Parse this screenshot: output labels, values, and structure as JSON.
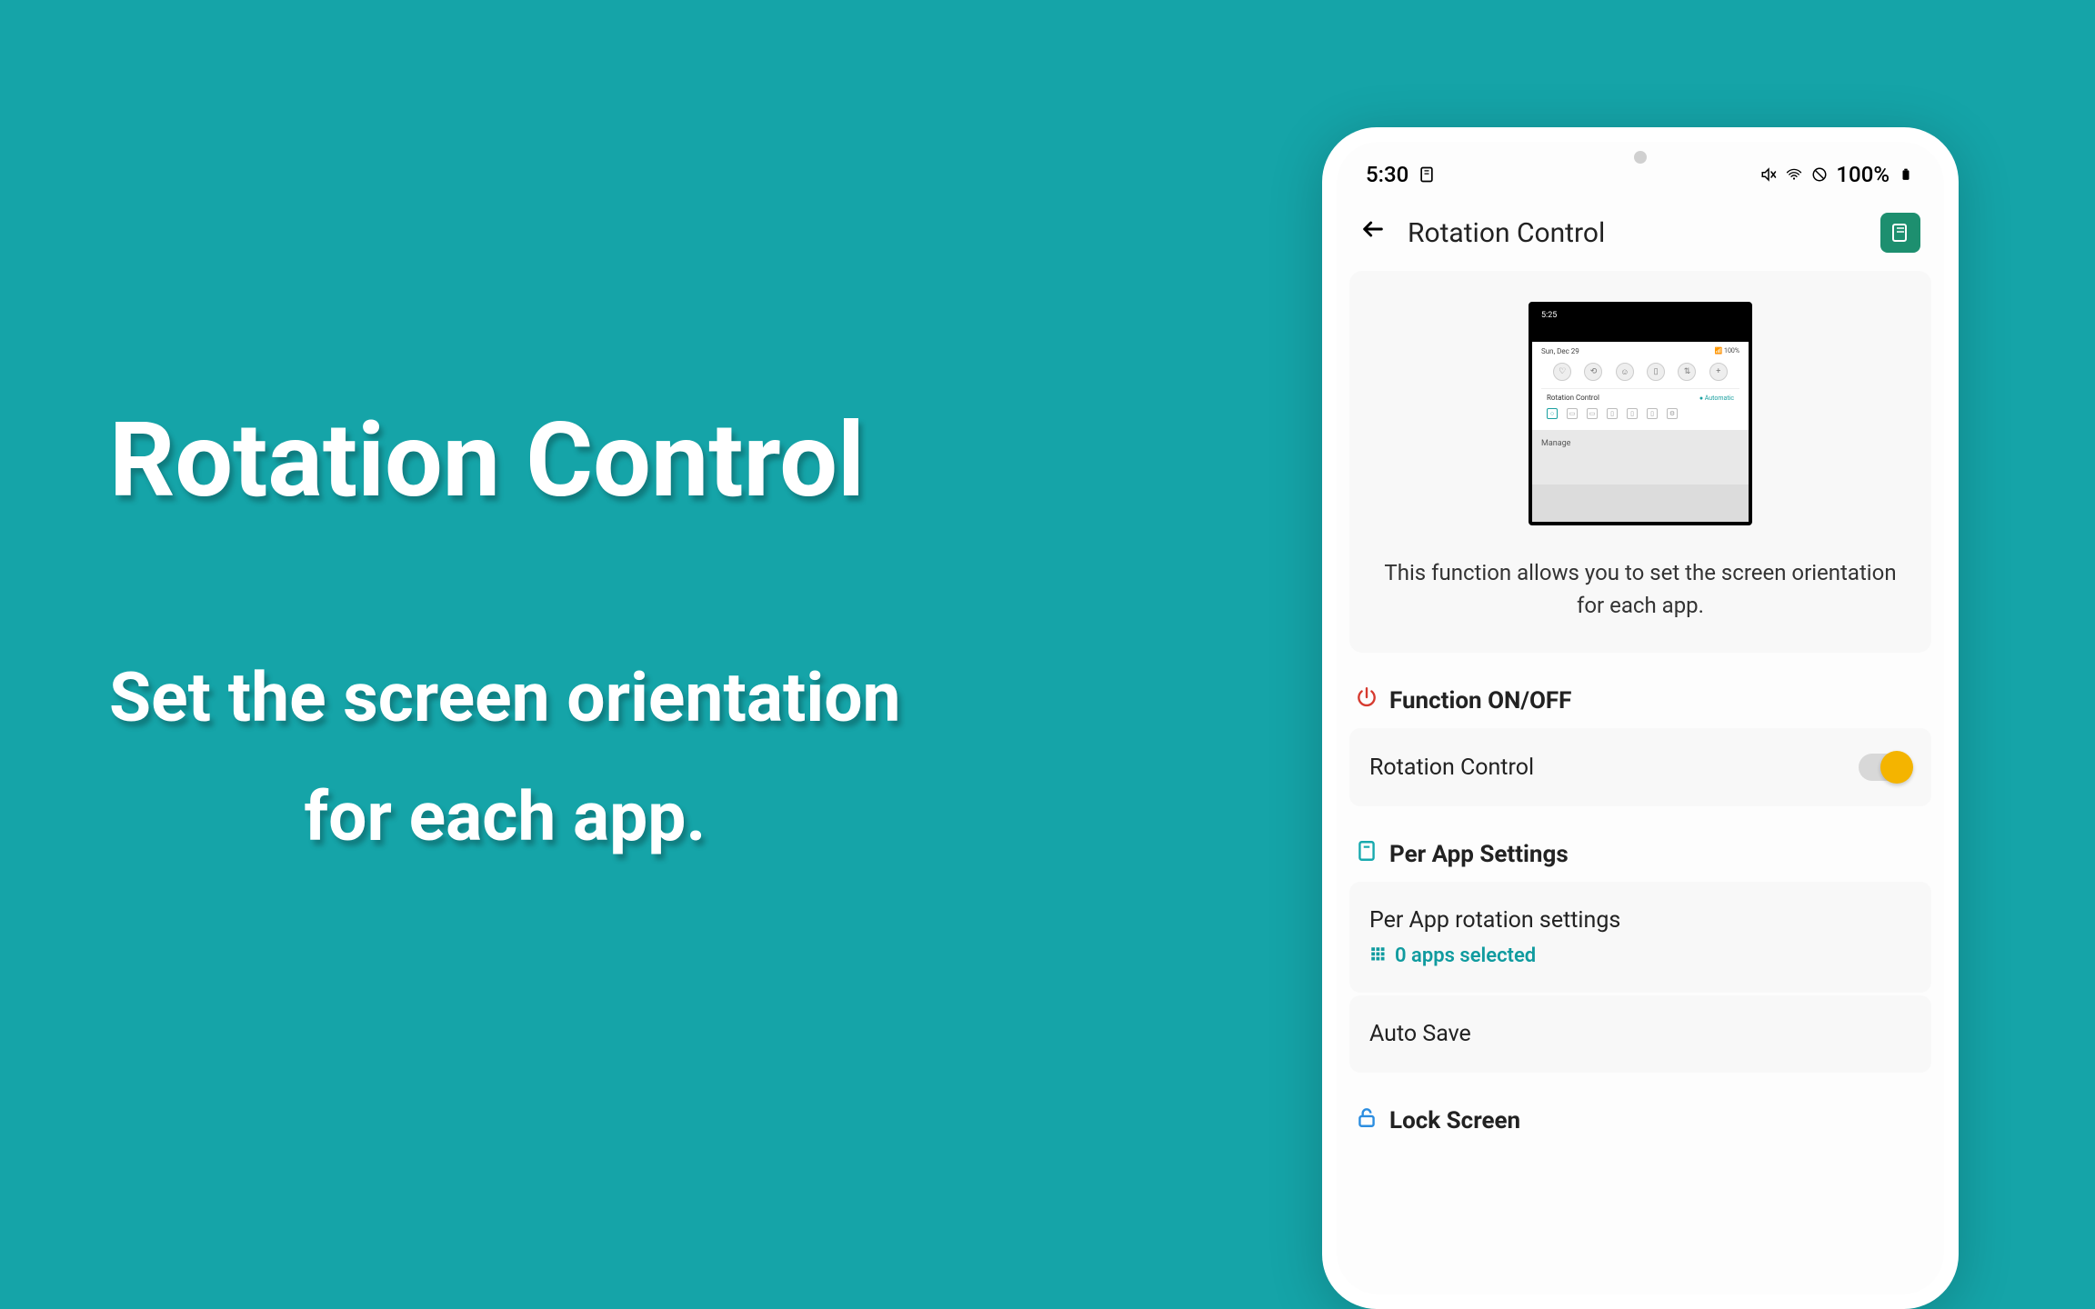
{
  "promo": {
    "title": "Rotation Control",
    "subtitle_line1": "Set the screen orientation",
    "subtitle_line2": "for each app."
  },
  "status": {
    "time": "5:30",
    "battery": "100%"
  },
  "appbar": {
    "title": "Rotation Control"
  },
  "preview": {
    "time": "5:25",
    "date": "Sun, Dec 29",
    "notif_title": "Rotation Control",
    "automatic": "Automatic",
    "manage": "Manage"
  },
  "card": {
    "description": "This function allows you to set the screen orientation for each app."
  },
  "sections": {
    "function": {
      "title": "Function ON/OFF",
      "item_label": "Rotation Control",
      "toggle_on": true
    },
    "perapp": {
      "title": "Per App Settings",
      "item1_label": "Per App rotation settings",
      "item1_sub": "0 apps selected",
      "item2_label": "Auto Save"
    },
    "lock": {
      "title": "Lock Screen"
    }
  }
}
